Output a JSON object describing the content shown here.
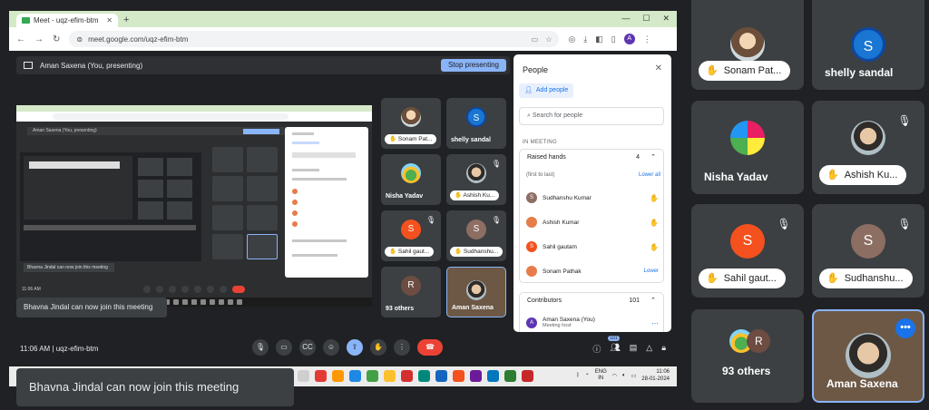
{
  "browser": {
    "tab_title": "Meet - uqz-efim-btm",
    "url": "meet.google.com/uqz-efim-btm",
    "profile_initial": "A"
  },
  "presenting": {
    "text": "Aman Saxena (You, presenting)",
    "stop_label": "Stop presenting"
  },
  "shared_screen": {
    "presenting_text": "Aman Saxena (You, presenting)",
    "toast": "Bhavna Jindal can now join this meeting",
    "time": "11:06 AM"
  },
  "mid_tiles": [
    {
      "name": "Sonam Pat...",
      "type": "pill",
      "initial": "",
      "color": "#a1887f"
    },
    {
      "name": "shelly sandal",
      "type": "name",
      "initial": "S",
      "color": "#1976d2"
    },
    {
      "name": "Nisha Yadav",
      "type": "name",
      "initial": "",
      "color": "#8bc34a"
    },
    {
      "name": "Ashish Ku...",
      "type": "pill",
      "initial": "",
      "color": "#8d6e63"
    },
    {
      "name": "Sahil gaut...",
      "type": "pill",
      "initial": "S",
      "color": "#f4511e"
    },
    {
      "name": "Sudhanshu...",
      "type": "pill",
      "initial": "S",
      "color": "#8d6e63"
    },
    {
      "name": "93 others",
      "type": "name",
      "initial": "R",
      "color": "#6d4c41"
    },
    {
      "name": "Aman Saxena",
      "type": "name",
      "initial": "",
      "color": "#6d5846"
    }
  ],
  "people_panel": {
    "title": "People",
    "add_people": "Add people",
    "search_placeholder": "Search for people",
    "in_meeting": "IN MEETING",
    "raised_hands_label": "Raised hands",
    "raised_hands_count": "4",
    "first_to_last": "(first to last)",
    "lower_all": "Lower all",
    "raised": [
      {
        "name": "Sudhanshu Kumar",
        "initial": "S",
        "color": "#8d6e63"
      },
      {
        "name": "Ashish Kumar",
        "initial": "A",
        "color": "#8d6e63"
      },
      {
        "name": "Sahil gautam",
        "initial": "S",
        "color": "#f4511e"
      },
      {
        "name": "Sonam Pathak",
        "initial": "S",
        "color": "#a1887f"
      }
    ],
    "lower_label": "Lower",
    "contributors_label": "Contributors",
    "contributors_count": "101",
    "contributor_name": "Aman Saxena (You)",
    "contributor_sub": "Meeting host"
  },
  "meet_bottom": {
    "time_code": "11:06 AM  |  uqz-efim-btm",
    "participants_badge": "101"
  },
  "taskbar": {
    "lang": "ENG\nIN",
    "clock_time": "11:06",
    "clock_date": "28-01-2024"
  },
  "toast": "Bhavna Jindal can now join this meeting",
  "right_tiles": [
    {
      "name": "Sonam Pat...",
      "style": "pill",
      "hand": true,
      "initial": "",
      "avatar_class": "photo"
    },
    {
      "name": "shelly sandal",
      "style": "name",
      "hand": false,
      "initial": "S",
      "avatar_color": "#1976d2"
    },
    {
      "name": "Nisha Yadav",
      "style": "name",
      "hand": false,
      "initial": "",
      "avatar_class": "photo3"
    },
    {
      "name": "Ashish Ku...",
      "style": "pill",
      "hand": true,
      "initial": "",
      "avatar_class": "photo2",
      "muted": true
    },
    {
      "name": "Sahil gaut...",
      "style": "pill",
      "hand": true,
      "initial": "S",
      "avatar_color": "#f4511e",
      "muted": true
    },
    {
      "name": "Sudhanshu...",
      "style": "pill",
      "hand": true,
      "initial": "S",
      "avatar_color": "#8d6e63",
      "muted": true
    },
    {
      "name": "93 others",
      "style": "name",
      "hand": false,
      "initial": "R",
      "avatar_color": "#6d4c41"
    },
    {
      "name": "Aman Saxena",
      "style": "name",
      "hand": false,
      "initial": "",
      "selected": true
    }
  ]
}
